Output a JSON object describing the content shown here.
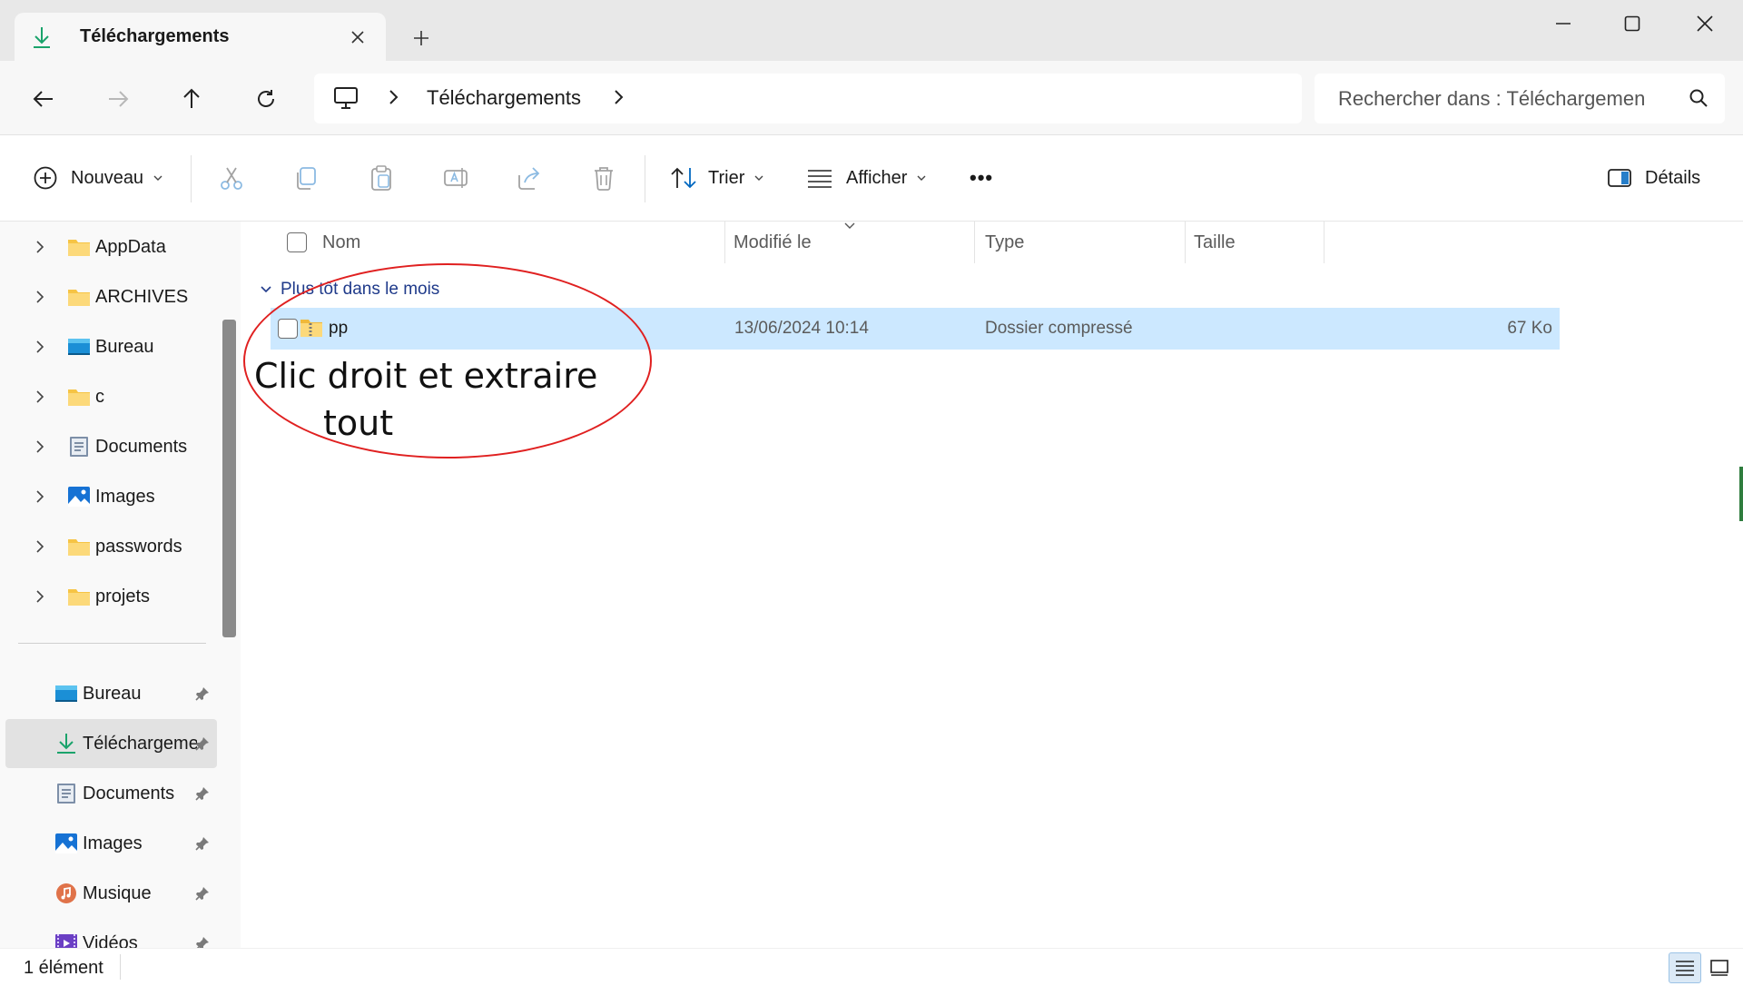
{
  "window": {
    "tab_title": "Téléchargements",
    "tab_icon": "download-icon",
    "controls": [
      "minimize-icon",
      "maximize-icon",
      "close-icon"
    ]
  },
  "address_bar": {
    "location_icon": "computer-icon",
    "path": [
      "Téléchargements"
    ],
    "search_placeholder": "Rechercher dans : Téléchargemen"
  },
  "toolbar": {
    "new_label": "Nouveau",
    "sort_label": "Trier",
    "view_label": "Afficher",
    "more_label": "•••",
    "details_label": "Détails",
    "disabled_actions": [
      "cut-icon",
      "copy-icon",
      "paste-icon",
      "rename-icon",
      "share-icon",
      "delete-icon"
    ]
  },
  "sidebar": {
    "tree": [
      {
        "label": "AppData",
        "icon": "folder-icon"
      },
      {
        "label": "ARCHIVES",
        "icon": "folder-icon"
      },
      {
        "label": "Bureau",
        "icon": "desktop-icon"
      },
      {
        "label": "c",
        "icon": "folder-icon"
      },
      {
        "label": "Documents",
        "icon": "documents-icon"
      },
      {
        "label": "Images",
        "icon": "pictures-icon"
      },
      {
        "label": "passwords",
        "icon": "folder-icon"
      },
      {
        "label": "projets",
        "icon": "folder-icon"
      }
    ],
    "quick_access": [
      {
        "label": "Bureau",
        "icon": "desktop-icon"
      },
      {
        "label": "Téléchargements",
        "icon": "download-icon",
        "selected": true
      },
      {
        "label": "Documents",
        "icon": "documents-icon"
      },
      {
        "label": "Images",
        "icon": "pictures-icon"
      },
      {
        "label": "Musique",
        "icon": "music-icon"
      },
      {
        "label": "Vidéos",
        "icon": "videos-icon"
      }
    ]
  },
  "file_list": {
    "columns": [
      "Nom",
      "Modifié le",
      "Type",
      "Taille"
    ],
    "group_label": "Plus tôt dans le mois",
    "rows": [
      {
        "name": "pp",
        "modified": "13/06/2024 10:14",
        "type": "Dossier compressé",
        "size": "67 Ko",
        "icon": "zip-folder-icon"
      }
    ]
  },
  "annotation": {
    "line1": "Clic droit et extraire",
    "line2": "tout",
    "color": "#e02020"
  },
  "status": {
    "count": "1 élément"
  },
  "colors": {
    "selection": "#cce8ff",
    "accent": "#0067c0",
    "folder": "#f6c445"
  }
}
